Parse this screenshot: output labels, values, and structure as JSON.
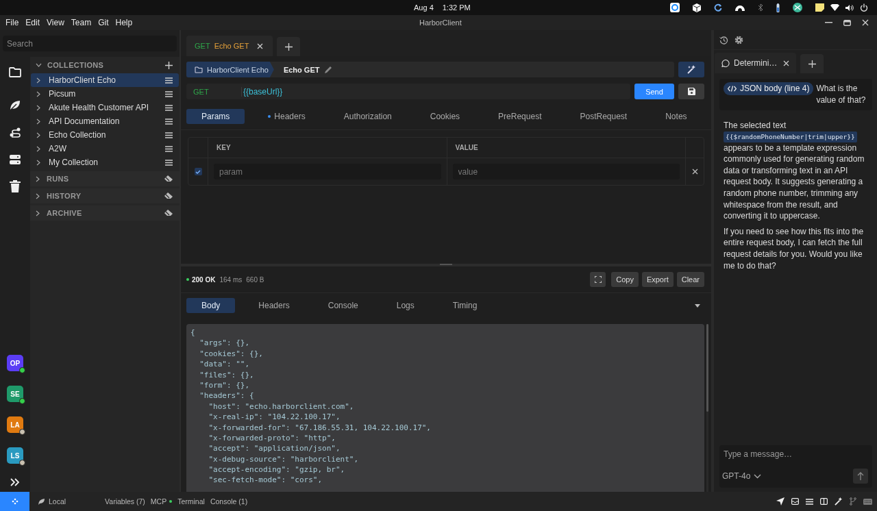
{
  "system_bar": {
    "date": "Aug 4",
    "time": "1:32 PM"
  },
  "menu": [
    "File",
    "Edit",
    "View",
    "Team",
    "Git",
    "Help"
  ],
  "window": {
    "title": "HarborClient"
  },
  "sidebar": {
    "search": {
      "placeholder": "Search"
    },
    "collections_header": "COLLECTIONS",
    "collections": [
      {
        "name": "HarborClient Echo",
        "selected": true
      },
      {
        "name": "Picsum",
        "selected": false
      },
      {
        "name": "Akute Health Customer API",
        "selected": false
      },
      {
        "name": "API Documentation",
        "selected": false
      },
      {
        "name": "Echo Collection",
        "selected": false
      },
      {
        "name": "A2W",
        "selected": false
      },
      {
        "name": "My Collection",
        "selected": false
      }
    ],
    "sections": [
      "RUNS",
      "HISTORY",
      "ARCHIVE"
    ]
  },
  "workspaces": [
    {
      "initials": "OP",
      "color": "#5b3df5",
      "online": true
    },
    {
      "initials": "SE",
      "color": "#1f9a6a",
      "online": true
    },
    {
      "initials": "LA",
      "color": "#e07a10",
      "online": false
    },
    {
      "initials": "LS",
      "color": "#2a9ac0",
      "online": false
    }
  ],
  "request_tabs": [
    {
      "method": "GET",
      "name": "Echo GET",
      "selected": true
    }
  ],
  "breadcrumb": {
    "collection": "HarborClient Echo",
    "request": "Echo GET"
  },
  "url_bar": {
    "method": "GET",
    "url": "{{baseUrl}}"
  },
  "send_button": "Send",
  "request_section_tabs": [
    {
      "label": "Params",
      "selected": true,
      "dot": false
    },
    {
      "label": "Headers",
      "selected": false,
      "dot": true
    },
    {
      "label": "Authorization",
      "selected": false,
      "dot": false
    },
    {
      "label": "Cookies",
      "selected": false,
      "dot": false
    },
    {
      "label": "PreRequest",
      "selected": false,
      "dot": false
    },
    {
      "label": "PostRequest",
      "selected": false,
      "dot": false
    },
    {
      "label": "Notes",
      "selected": false,
      "dot": false
    }
  ],
  "params_table": {
    "columns": [
      "KEY",
      "VALUE"
    ],
    "rows": [
      {
        "checked": true,
        "key": {
          "placeholder": "param"
        },
        "value": {
          "placeholder": "value"
        }
      }
    ]
  },
  "response": {
    "status": "200 OK",
    "time": "164 ms",
    "size": "660 B",
    "buttons": [
      "Copy",
      "Export",
      "Clear"
    ],
    "tabs": [
      {
        "label": "Body",
        "selected": true
      },
      {
        "label": "Headers",
        "selected": false
      },
      {
        "label": "Console",
        "selected": false
      },
      {
        "label": "Logs",
        "selected": false
      },
      {
        "label": "Timing",
        "selected": false
      }
    ],
    "body_lines": [
      "{",
      "  \"args\": {},",
      "  \"cookies\": {},",
      "  \"data\": \"\",",
      "  \"files\": {},",
      "  \"form\": {},",
      "  \"headers\": {",
      "    \"host\": \"echo.harborclient.com\",",
      "    \"x-real-ip\": \"104.22.100.17\",",
      "    \"x-forwarded-for\": \"67.186.55.31, 104.22.100.17\",",
      "    \"x-forwarded-proto\": \"http\",",
      "    \"accept\": \"application/json\",",
      "    \"x-debug-source\": \"harborclient\",",
      "    \"accept-encoding\": \"gzip, br\",",
      "    \"sec-fetch-mode\": \"cors\","
    ]
  },
  "chat": {
    "tabs": [
      {
        "title": "Determini…",
        "selected": true
      }
    ],
    "user_message": {
      "chip": "JSON body (line 4)",
      "text": "What is the value of that?"
    },
    "reply": [
      {
        "before": "The selected text",
        "code": "{{$randomPhoneNumber|trim|upper}}",
        "after": "appears to be a template expression commonly used for generating random data or transforming text in an API request body. It suggests generating a random phone number, trimming any whitespace from the result, and converting it to uppercase."
      },
      {
        "before": "If you need to see how this fits into the entire request body, I can fetch the full request details for you. Would you like me to do that?"
      }
    ],
    "input": {
      "placeholder": "Type a message…"
    },
    "model": "GPT-4o"
  },
  "status_bar": {
    "environment": "Local",
    "items": [
      {
        "label": "Variables (7)",
        "dot": false
      },
      {
        "label": "MCP",
        "dot": true
      },
      {
        "label": "Terminal",
        "dot": false
      },
      {
        "label": "Console (1)",
        "dot": false
      }
    ]
  }
}
